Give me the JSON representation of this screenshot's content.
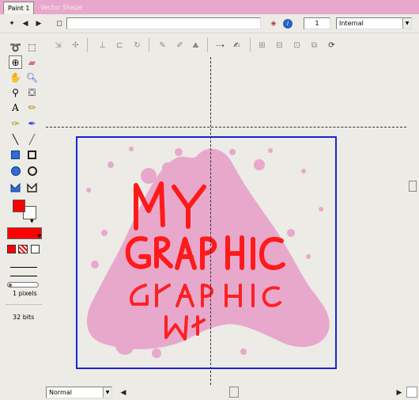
{
  "tabs": [
    {
      "label": "Paint 1"
    },
    {
      "label": "Vector Shape"
    }
  ],
  "toolbar1": {
    "frame_value": "",
    "number_value": "1",
    "mode_value": "Internal"
  },
  "tools": {
    "brush_size_label": "1 pixels",
    "bits_label": "32 bits",
    "primary_color": "#ff0000",
    "secondary_color": "#ffffff"
  },
  "canvas": {
    "artwork_text_line1": "MY",
    "artwork_text_line2": "GRAPHIC",
    "artwork_mirror_line1": "GRAPHIC",
    "artwork_mirror_line2": "MY",
    "splash_color": "#e8a8cc",
    "text_color": "#ff1a1a",
    "frame_color": "#1726d6"
  },
  "bottombar": {
    "blend_mode": "Normal"
  },
  "icons": [
    "select-arrow-icon",
    "lasso-icon",
    "marquee-icon",
    "registration-icon",
    "eraser-icon",
    "hand-icon",
    "zoom-icon",
    "eyedropper-icon",
    "paint-bucket-icon",
    "text-icon",
    "pencil-icon",
    "brush-icon",
    "line-icon",
    "rectangle-icon",
    "ellipse-icon",
    "polygon-icon",
    "info-icon"
  ]
}
